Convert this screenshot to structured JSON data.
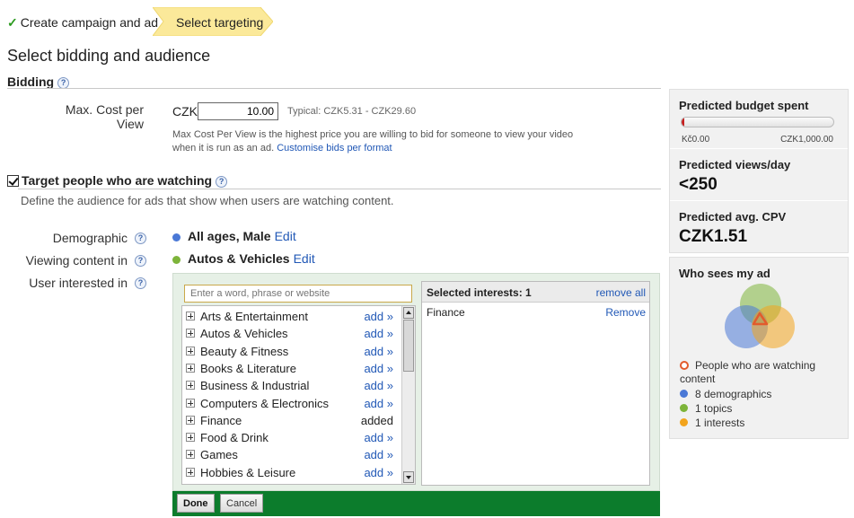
{
  "steps": {
    "step1": "Create campaign and ad",
    "step2": "Select targeting"
  },
  "page_title": "Select bidding and audience",
  "bidding": {
    "heading": "Bidding",
    "max_cpv_label": "Max. Cost per View",
    "currency": "CZK",
    "max_cpv_value": "10.00",
    "typical": "Typical: CZK5.31 - CZK29.60",
    "help_text": "Max Cost Per View is the highest price you are willing to bid for someone to view your video when it is run as an ad.",
    "customise_link": "Customise bids per format"
  },
  "targeting": {
    "heading": "Target people who are watching",
    "description": "Define the audience for ads that show when users are watching content.",
    "demographic_label": "Demographic",
    "demographic_value": "All ages, Male",
    "viewing_label": "Viewing content in",
    "viewing_value": "Autos & Vehicles",
    "interested_label": "User interested in",
    "edit_label": "Edit",
    "colors": {
      "demographic": "#4a78d6",
      "viewing": "#7db43a",
      "interest": "#f2a41d",
      "watching": "#e25b2c"
    }
  },
  "picker": {
    "search_placeholder": "Enter a word, phrase or website",
    "categories": [
      {
        "name": "Arts & Entertainment",
        "action": "add »"
      },
      {
        "name": "Autos & Vehicles",
        "action": "add »"
      },
      {
        "name": "Beauty & Fitness",
        "action": "add »"
      },
      {
        "name": "Books & Literature",
        "action": "add »"
      },
      {
        "name": "Business & Industrial",
        "action": "add »"
      },
      {
        "name": "Computers & Electronics",
        "action": "add »"
      },
      {
        "name": "Finance",
        "action": "added"
      },
      {
        "name": "Food & Drink",
        "action": "add »"
      },
      {
        "name": "Games",
        "action": "add »"
      },
      {
        "name": "Hobbies & Leisure",
        "action": "add »"
      }
    ],
    "selected_title": "Selected interests: 1",
    "remove_all": "remove all",
    "selected": [
      {
        "name": "Finance",
        "action": "Remove"
      }
    ],
    "done_label": "Done",
    "cancel_label": "Cancel"
  },
  "sidebar": {
    "budget_title": "Predicted budget spent",
    "budget_min": "Kč0.00",
    "budget_max": "CZK1,000.00",
    "budget_fraction": 0.02,
    "views_title": "Predicted views/day",
    "views_value": "<250",
    "cpv_title": "Predicted avg. CPV",
    "cpv_value": "CZK1.51",
    "who_title": "Who sees my ad",
    "legend": [
      {
        "text": "People who are watching content",
        "icon": "ring",
        "color": "#e25b2c"
      },
      {
        "text": "8 demographics",
        "icon": "dot",
        "color": "#4a78d6"
      },
      {
        "text": "1 topics",
        "icon": "dot",
        "color": "#7db43a"
      },
      {
        "text": "1 interests",
        "icon": "dot",
        "color": "#f2a41d"
      }
    ]
  }
}
